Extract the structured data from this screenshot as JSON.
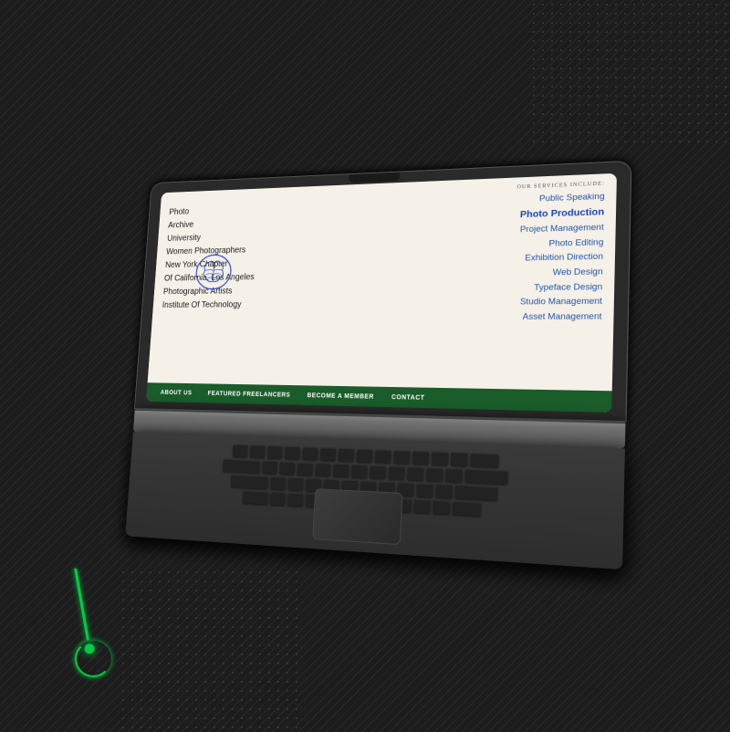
{
  "background": {
    "color": "#1c1c1c"
  },
  "website": {
    "services_label": "OUR SERVICES INCLUDE:",
    "services": [
      {
        "text": "Public Speaking",
        "highlighted": false
      },
      {
        "text": "Photo Production",
        "highlighted": true
      },
      {
        "text": "Project Management",
        "highlighted": false
      },
      {
        "text": "Photo Editing",
        "highlighted": false
      },
      {
        "text": "Exhibition Direction",
        "highlighted": false
      },
      {
        "text": "Web Design",
        "highlighted": false
      },
      {
        "text": "Typeface Design",
        "highlighted": false
      },
      {
        "text": "Studio Management",
        "highlighted": false
      },
      {
        "text": "Asset Management",
        "highlighted": false
      }
    ],
    "left_items": [
      "Photo",
      "Archive",
      "University",
      "Women Photographers",
      "New York Chapter",
      "Of California, Los Angeles",
      "Photographic Artists",
      "Institute Of Technology"
    ],
    "nav_items": [
      "ABOUT US",
      "FEATURED FREELANCERS",
      "BECOME A MEMBER",
      "CONTACT"
    ]
  }
}
